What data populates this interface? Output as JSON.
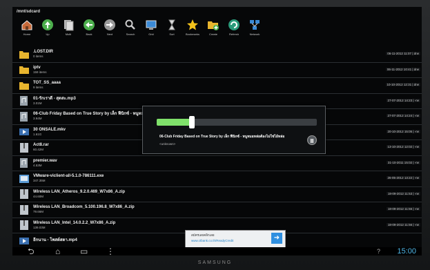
{
  "path": "/mnt/sdcard",
  "toolbar": [
    {
      "label": "Home",
      "icon": "home-icon"
    },
    {
      "label": "Up",
      "icon": "up-arrow-icon"
    },
    {
      "label": "Multi",
      "icon": "multi-select-icon"
    },
    {
      "label": "Back",
      "icon": "back-arrow-icon"
    },
    {
      "label": "Next",
      "icon": "next-arrow-icon"
    },
    {
      "label": "Search",
      "icon": "search-icon"
    },
    {
      "label": "Grid",
      "icon": "grid-icon"
    },
    {
      "label": "Sort",
      "icon": "sort-icon"
    },
    {
      "label": "Bookmarks",
      "icon": "star-icon"
    },
    {
      "label": "Create",
      "icon": "create-folder-icon"
    },
    {
      "label": "Refresh",
      "icon": "refresh-icon"
    },
    {
      "label": "Network",
      "icon": "network-icon"
    }
  ],
  "files": [
    {
      "name": ".LOST.DIR",
      "sub": "0 items",
      "date": "06-11-2012 11:07 | drw",
      "type": "folder"
    },
    {
      "name": "iptv",
      "sub": "159 items",
      "date": "06-11-2012 10:41 | drw",
      "type": "folder"
    },
    {
      "name": "TOT_SS_aaaa",
      "sub": "9 items",
      "date": "10-10-2012 12:31 | drw",
      "type": "folder"
    },
    {
      "name": "01-รักเราดี - สุดสะ.mp3",
      "sub": "3.01M",
      "date": "27-07-2012 14:23 | -rw",
      "type": "audio"
    },
    {
      "name": "06-Club Friday Based on True Story by เล็ก ฟีนิกซ์ - หนูหมอหล่อต้องไม่ใช่ไอ้หล่อ",
      "sub": "3.94M",
      "date": "27-07-2012 14:24 | -rw",
      "type": "audio"
    },
    {
      "name": "30 ONSALE.mkv",
      "sub": "1.61G",
      "date": "20-10-2012 15:05 | -rw",
      "type": "video"
    },
    {
      "name": "Act8.rar",
      "sub": "60.42M",
      "date": "13-10-2012 12:02 | -rw",
      "type": "archive"
    },
    {
      "name": "premier.wav",
      "sub": "4.53M",
      "date": "31-10-2011 15:02 | -rw",
      "type": "audio"
    },
    {
      "name": "VMware-viclient-all-5.1.0-786111.exe",
      "sub": "347.35M",
      "date": "26-05-2012 13:22 | -rw",
      "type": "exe"
    },
    {
      "name": "Wireless LAN_Atheros_9.2.0.469_W7x86_A.zip",
      "sub": "44.60M",
      "date": "18-09-2012 11:53 | -rw",
      "type": "archive"
    },
    {
      "name": "Wireless LAN_Broadcom_5.100.196.8_W7x86_A.zip",
      "sub": "79.66M",
      "date": "18-09-2012 11:55 | -rw",
      "type": "archive"
    },
    {
      "name": "Wireless LAN_Intel_14.0.2.2_W7x86_A.zip",
      "sub": "139.03M",
      "date": "18-09-2012 11:56 | -rw",
      "type": "archive"
    },
    {
      "name": "อีกนาน - โพสต์สตา.mp4",
      "sub": "",
      "date": "",
      "type": "video"
    }
  ],
  "dialog": {
    "title": "06-Club Friday Based on True Story by เล็ก ฟีนิกซ์ - หนูหมอหล่อต้องไม่ใช่ไอ้หล่อ",
    "subtitle": "<unknown>",
    "progress": 0.22
  },
  "ad": {
    "line1": "สมัครเลยคลิกเลย",
    "line2": "www.ctbank.co.th/ReadyCredit",
    "arrow": "➜"
  },
  "navbar": {
    "back": "⮌",
    "home": "⌂",
    "recent": "▭",
    "menu": "⋮",
    "clock": "15:00",
    "signal": "?"
  },
  "brand": "SAMSUNG",
  "colors": {
    "accent": "#4fb7e8",
    "progress": "#7fe06a",
    "folder": "#e8b52e"
  }
}
